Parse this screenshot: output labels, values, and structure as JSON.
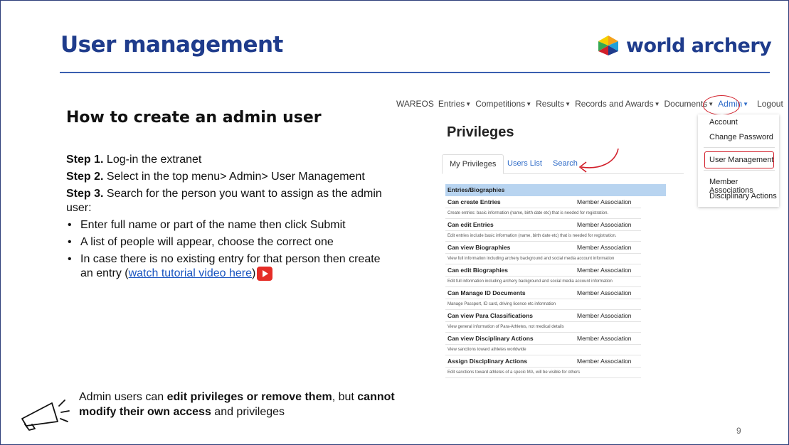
{
  "slide": {
    "title": "User management",
    "logo_text": "world archery",
    "subheading": "How to create an admin user",
    "steps": [
      {
        "label": "Step 1.",
        "text": " Log-in the extranet"
      },
      {
        "label": "Step 2.",
        "text": " Select in the top menu> Admin> User Management"
      },
      {
        "label": "Step 3.",
        "text": " Search for the person you want to assign as the admin user:"
      }
    ],
    "bullets": [
      "Enter full name or part of the name then click Submit",
      "A list of people will appear, choose the correct one"
    ],
    "bullet3_text": "In case there is no existing entry for that person then create an entry (",
    "bullet3_link": "watch tutorial video here",
    "bullet3_tail": ")",
    "note": {
      "p1": "Admin users can ",
      "b1": "edit privileges or remove them",
      "p2": ", but ",
      "b2": "cannot modify their own access",
      "p3": " and privileges"
    },
    "page_number": "9"
  },
  "nav": {
    "items": [
      "WAREOS",
      "Entries",
      "Competitions",
      "Results",
      "Records and Awards",
      "Documents",
      "Admin",
      "Logout"
    ]
  },
  "dropdown": {
    "items": [
      "Account",
      "Change Password",
      "User Management",
      "Member Associations",
      "Disciplinary Actions"
    ]
  },
  "privileges": {
    "title": "Privileges",
    "tabs": [
      "My Privileges",
      "Users List",
      "Search"
    ],
    "section": "Entries/Biographies",
    "rows": [
      {
        "name": "Can create Entries",
        "scope": "Member Association",
        "desc": "Create entries: basic information (name, birth date etc) that is needed for registration."
      },
      {
        "name": "Can edit Entries",
        "scope": "Member Association",
        "desc": "Edit entries include basic information (name, birth date etc) that is needed for registration."
      },
      {
        "name": "Can view Biographies",
        "scope": "Member Association",
        "desc": "View full information including archery background and social media account information"
      },
      {
        "name": "Can edit Biographies",
        "scope": "Member Association",
        "desc": "Edit full information including archery background and social media account information"
      },
      {
        "name": "Can Manage ID Documents",
        "scope": "Member Association",
        "desc": "Manage Passport, ID card, driving licence etc information"
      },
      {
        "name": "Can view Para Classifications",
        "scope": "Member Association",
        "desc": "View general information of Para-Athletes, not medical details"
      },
      {
        "name": "Can view Disciplinary Actions",
        "scope": "Member Association",
        "desc": "View sanctions toward athletes worldwide"
      },
      {
        "name": "Assign Disciplinary Actions",
        "scope": "Member Association",
        "desc": "Edit sanctions toward athletes of a specic MA, will be visible for others"
      }
    ]
  },
  "colors": {
    "brand": "#1f3c8c",
    "accent_red": "#d21f2a",
    "table_header": "#b8d4f0",
    "link": "#2e6bc8"
  }
}
